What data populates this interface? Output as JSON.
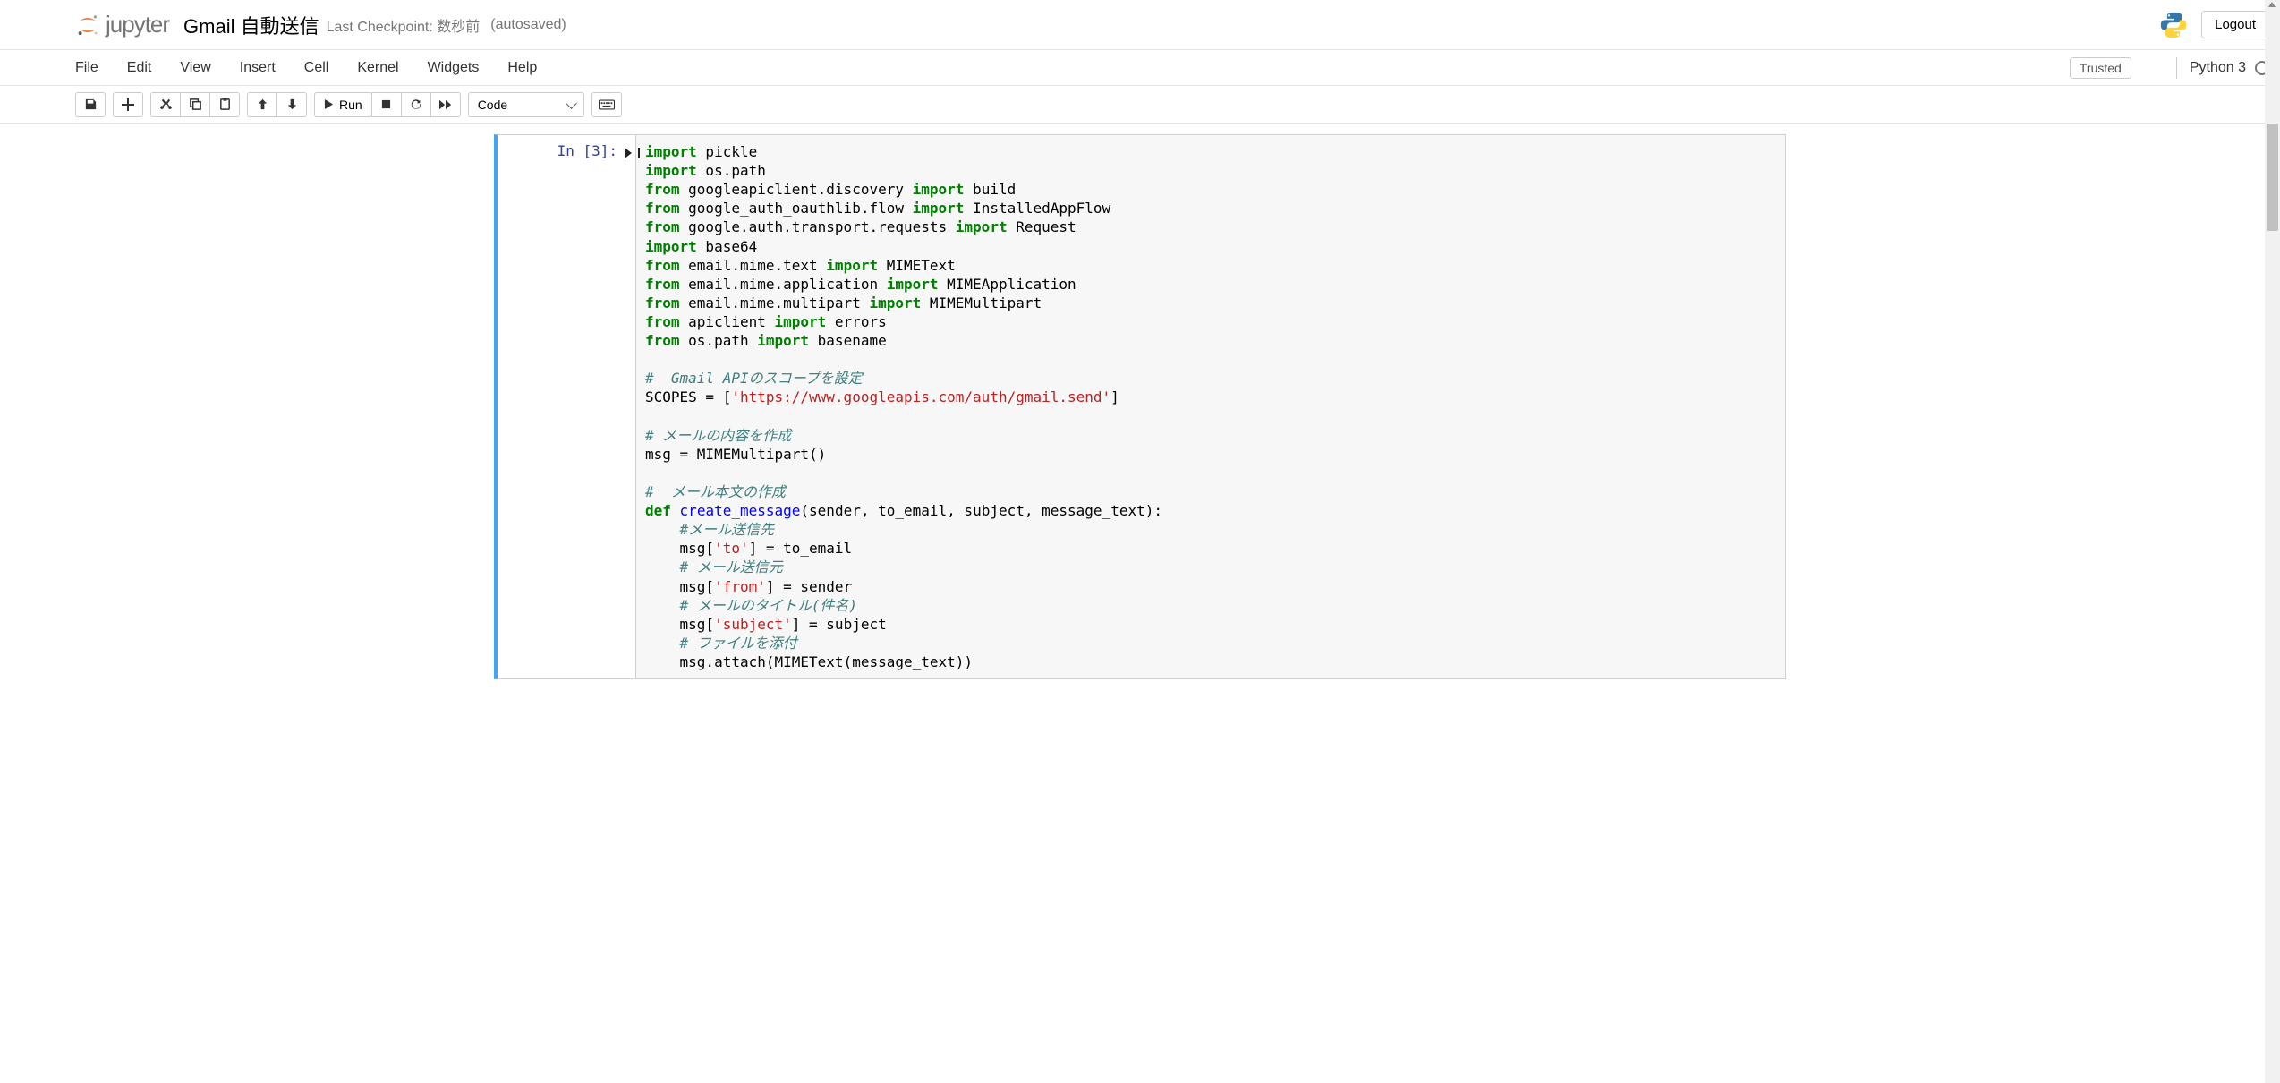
{
  "header": {
    "brand": "jupyter",
    "notebook_title": "Gmail 自動送信",
    "checkpoint_prefix": "Last Checkpoint:",
    "checkpoint_value": "数秒前",
    "autosave": "(autosaved)",
    "logout": "Logout"
  },
  "menubar": {
    "items": [
      "File",
      "Edit",
      "View",
      "Insert",
      "Cell",
      "Kernel",
      "Widgets",
      "Help"
    ],
    "trusted": "Trusted",
    "kernel_name": "Python 3"
  },
  "toolbar": {
    "run_label": "Run",
    "cell_type_selected": "Code"
  },
  "cell": {
    "prompt": "In [3]:",
    "code_lines": [
      [
        {
          "t": "import",
          "c": "kw"
        },
        {
          "t": " pickle"
        }
      ],
      [
        {
          "t": "import",
          "c": "kw"
        },
        {
          "t": " os.path"
        }
      ],
      [
        {
          "t": "from",
          "c": "kw"
        },
        {
          "t": " googleapiclient.discovery "
        },
        {
          "t": "import",
          "c": "kw"
        },
        {
          "t": " build"
        }
      ],
      [
        {
          "t": "from",
          "c": "kw"
        },
        {
          "t": " google_auth_oauthlib.flow "
        },
        {
          "t": "import",
          "c": "kw"
        },
        {
          "t": " InstalledAppFlow"
        }
      ],
      [
        {
          "t": "from",
          "c": "kw"
        },
        {
          "t": " google.auth.transport.requests "
        },
        {
          "t": "import",
          "c": "kw"
        },
        {
          "t": " Request"
        }
      ],
      [
        {
          "t": "import",
          "c": "kw"
        },
        {
          "t": " base64"
        }
      ],
      [
        {
          "t": "from",
          "c": "kw"
        },
        {
          "t": " email.mime.text "
        },
        {
          "t": "import",
          "c": "kw"
        },
        {
          "t": " MIMEText"
        }
      ],
      [
        {
          "t": "from",
          "c": "kw"
        },
        {
          "t": " email.mime.application "
        },
        {
          "t": "import",
          "c": "kw"
        },
        {
          "t": " MIMEApplication"
        }
      ],
      [
        {
          "t": "from",
          "c": "kw"
        },
        {
          "t": " email.mime.multipart "
        },
        {
          "t": "import",
          "c": "kw"
        },
        {
          "t": " MIMEMultipart"
        }
      ],
      [
        {
          "t": "from",
          "c": "kw"
        },
        {
          "t": " apiclient "
        },
        {
          "t": "import",
          "c": "kw"
        },
        {
          "t": " errors"
        }
      ],
      [
        {
          "t": "from",
          "c": "kw"
        },
        {
          "t": " os.path "
        },
        {
          "t": "import",
          "c": "kw"
        },
        {
          "t": " basename"
        }
      ],
      [],
      [
        {
          "t": "#  Gmail APIのスコープを設定",
          "c": "cm"
        }
      ],
      [
        {
          "t": "SCOPES = ["
        },
        {
          "t": "'https://www.googleapis.com/auth/gmail.send'",
          "c": "st"
        },
        {
          "t": "]"
        }
      ],
      [],
      [
        {
          "t": "# メールの内容を作成",
          "c": "cm"
        }
      ],
      [
        {
          "t": "msg = MIMEMultipart()"
        }
      ],
      [],
      [
        {
          "t": "#  メール本文の作成",
          "c": "cm"
        }
      ],
      [
        {
          "t": "def",
          "c": "kw"
        },
        {
          "t": " "
        },
        {
          "t": "create_message",
          "c": "fn"
        },
        {
          "t": "(sender, to_email, subject, message_text):"
        }
      ],
      [
        {
          "t": "    "
        },
        {
          "t": "#メール送信先",
          "c": "cm"
        }
      ],
      [
        {
          "t": "    msg["
        },
        {
          "t": "'to'",
          "c": "st"
        },
        {
          "t": "] = to_email"
        }
      ],
      [
        {
          "t": "    "
        },
        {
          "t": "# メール送信元",
          "c": "cm"
        }
      ],
      [
        {
          "t": "    msg["
        },
        {
          "t": "'from'",
          "c": "st"
        },
        {
          "t": "] = sender"
        }
      ],
      [
        {
          "t": "    "
        },
        {
          "t": "# メールのタイトル(件名)",
          "c": "cm"
        }
      ],
      [
        {
          "t": "    msg["
        },
        {
          "t": "'subject'",
          "c": "st"
        },
        {
          "t": "] = subject"
        }
      ],
      [
        {
          "t": "    "
        },
        {
          "t": "# ファイルを添付",
          "c": "cm"
        }
      ],
      [
        {
          "t": "    msg.attach(MIMEText(message_text))"
        }
      ]
    ]
  }
}
